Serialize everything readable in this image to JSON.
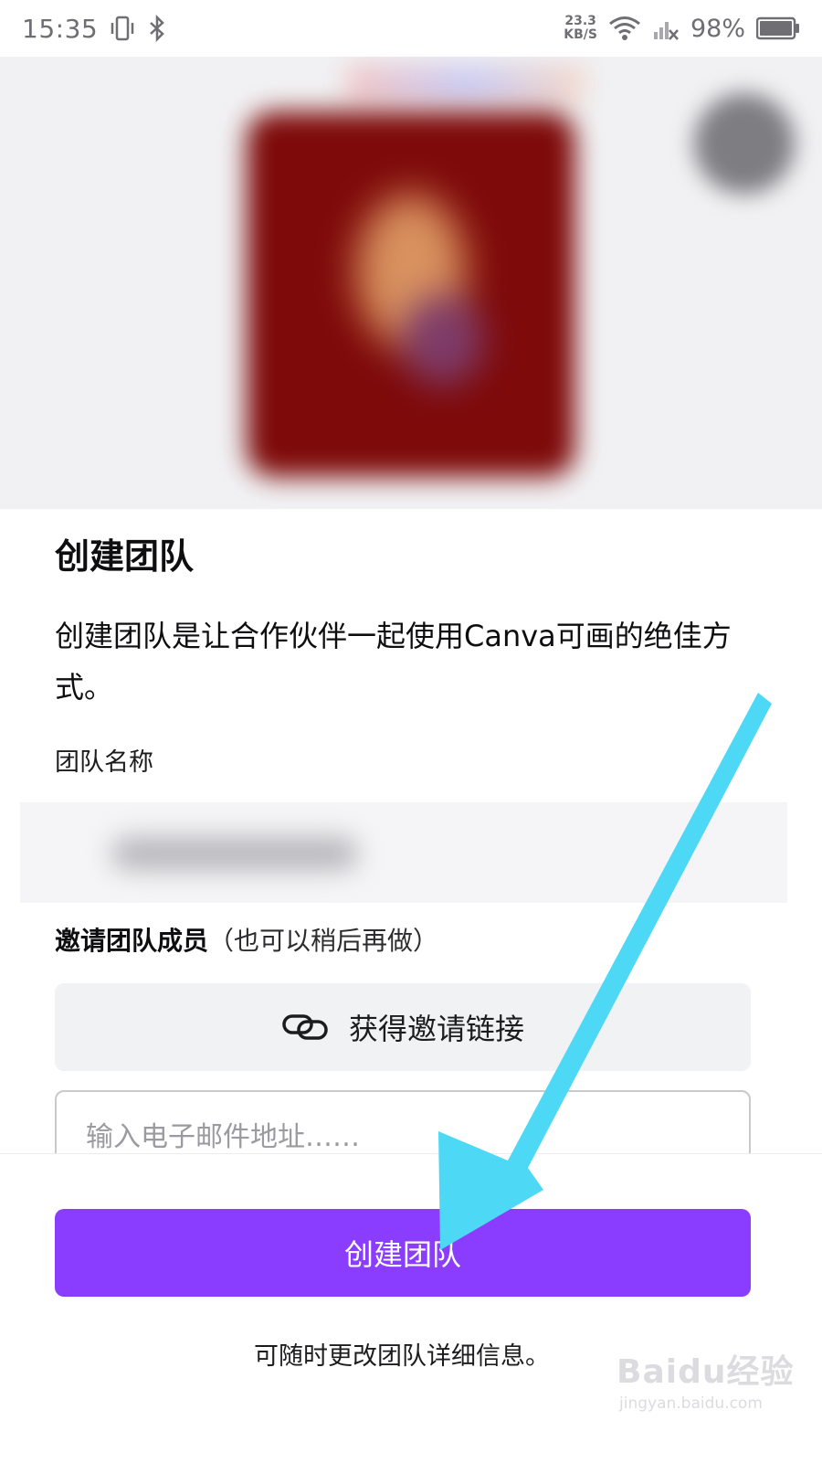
{
  "status_bar": {
    "time": "15:35",
    "network_speed_value": "23.3",
    "network_speed_unit": "KB/S",
    "battery_percent": "98%",
    "icons": [
      "vibrate-icon",
      "bluetooth-icon",
      "wifi-icon",
      "signal-off-icon",
      "battery-icon"
    ]
  },
  "dialog": {
    "title": "创建团队",
    "description": "创建团队是让合作伙伴一起使用Canva可画的绝佳方式。",
    "team_name_label": "团队名称",
    "invite_heading": "邀请团队成员",
    "invite_hint": "（也可以稍后再做）",
    "get_link_label": "获得邀请链接",
    "email_placeholder": "输入电子邮件地址……",
    "create_button_label": "创建团队",
    "footnote": "可随时更改团队详细信息。"
  },
  "watermark": {
    "brand": "Baidu经验",
    "url": "jingyan.baidu.com"
  },
  "colors": {
    "primary": "#8b3dff",
    "annotation_arrow": "#4dd9f5"
  }
}
